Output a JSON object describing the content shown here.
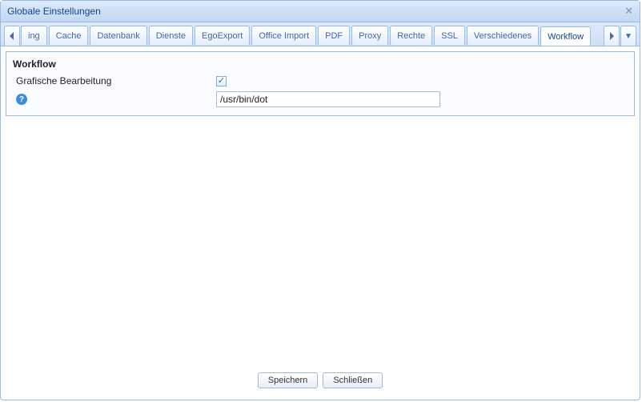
{
  "window": {
    "title": "Globale Einstellungen"
  },
  "tabs": {
    "truncated_first": "ing",
    "items": [
      "Cache",
      "Datenbank",
      "Dienste",
      "EgoExport",
      "Office Import",
      "PDF",
      "Proxy",
      "Rechte",
      "SSL",
      "Verschiedenes",
      "Workflow"
    ],
    "active": "Workflow"
  },
  "panel": {
    "title": "Workflow",
    "grafische_bearbeitung_label": "Grafische Bearbeitung",
    "grafische_bearbeitung_checked": true,
    "path_value": "/usr/bin/dot"
  },
  "buttons": {
    "save": "Speichern",
    "close": "Schließen"
  }
}
